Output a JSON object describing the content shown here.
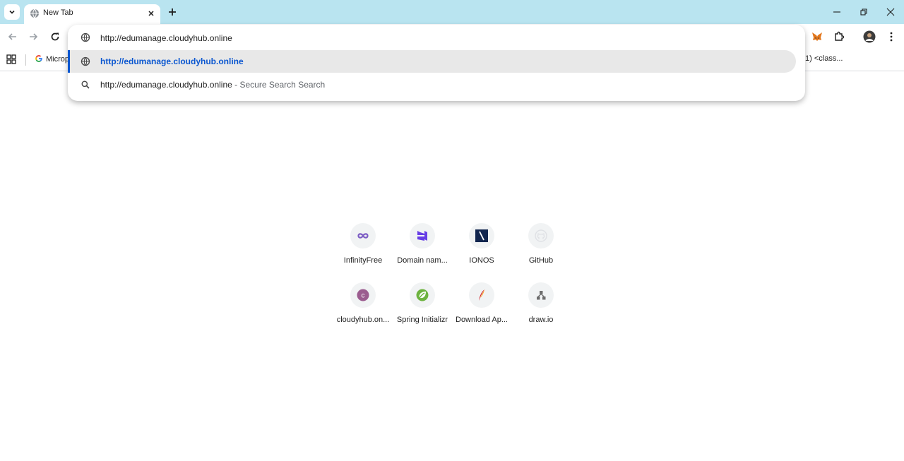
{
  "tab": {
    "title": "New Tab"
  },
  "omnibox": {
    "input_value": "http://edumanage.cloudyhub.online",
    "suggestions": [
      {
        "text": "http://edumanage.cloudyhub.online",
        "suffix": "",
        "icon": "globe-icon"
      },
      {
        "text": "http://edumanage.cloudyhub.online",
        "suffix": " - Secure Search Search",
        "icon": "search-icon"
      }
    ]
  },
  "bookmarks": {
    "items": [
      {
        "label": "Microp",
        "icon": "google-icon"
      },
      {
        "label": "1)  <class..."
      }
    ]
  },
  "shortcuts": [
    {
      "label": "InfinityFree",
      "icon": "infinity-icon",
      "color": "#7c5cc4"
    },
    {
      "label": "Domain nam...",
      "icon": "hostinger-icon",
      "color": "#673de6"
    },
    {
      "label": "IONOS",
      "icon": "ionos-icon",
      "color": "#11254e"
    },
    {
      "label": "GitHub",
      "icon": "github-icon",
      "color": "#dfe1e5"
    },
    {
      "label": "cloudyhub.on...",
      "icon": "letter-c-icon",
      "color": "#9b5c8f"
    },
    {
      "label": "Spring Initializr",
      "icon": "spring-icon",
      "color": "#6db33f"
    },
    {
      "label": "Download Ap...",
      "icon": "feather-icon",
      "color": "#d22128"
    },
    {
      "label": "draw.io",
      "icon": "drawio-icon",
      "color": "#6e6e6e"
    }
  ],
  "shortcut_letters": {
    "cloudyhub": "c"
  }
}
